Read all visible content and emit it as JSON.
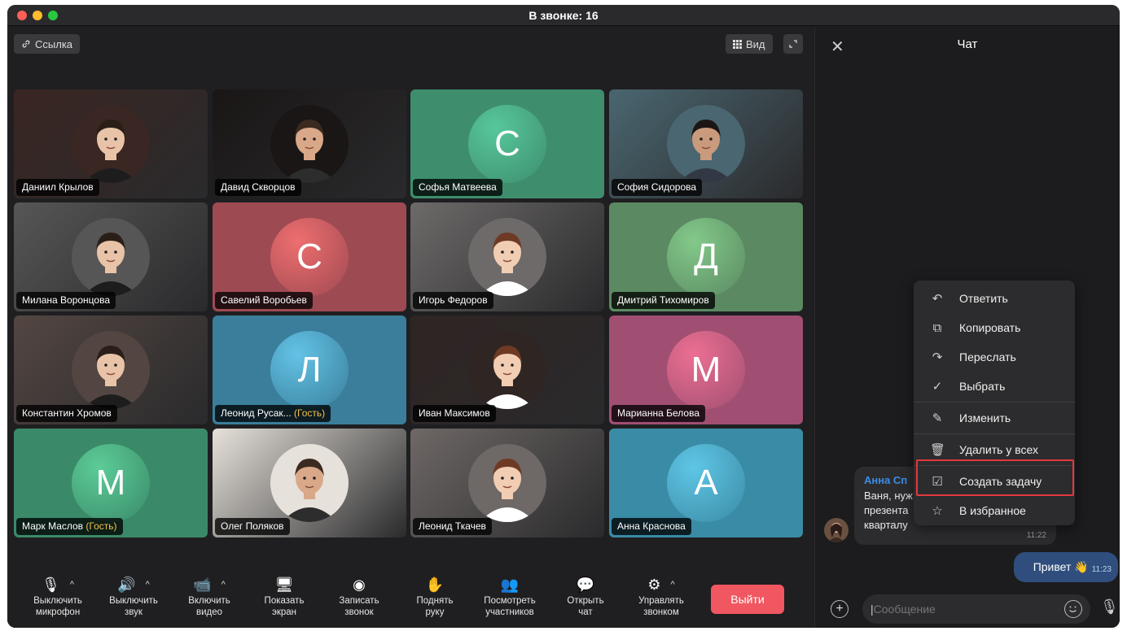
{
  "window": {
    "title": "В звонке: 16"
  },
  "stage": {
    "link_label": "Ссылка",
    "view_label": "Вид"
  },
  "participants": [
    {
      "name": "Даниил Крылов",
      "kind": "photo",
      "bg": "#3a2622"
    },
    {
      "name": "Давид Скворцов",
      "kind": "photo",
      "bg": "#1a1616"
    },
    {
      "name": "Софья Матвеева",
      "kind": "letter",
      "letter": "С",
      "bg": "#3e8e6e",
      "circle": "#57c79b"
    },
    {
      "name": "София Сидорова",
      "kind": "photo",
      "bg": "#4a6670"
    },
    {
      "name": "Милана Воронцова",
      "kind": "photo",
      "bg": "#575656"
    },
    {
      "name": "Савелий Воробьев",
      "kind": "letter",
      "letter": "С",
      "bg": "#9e4a52",
      "circle": "#ee6e6f"
    },
    {
      "name": "Игорь Федоров",
      "kind": "photo",
      "bg": "#6d6a69"
    },
    {
      "name": "Дмитрий Тихомиров",
      "kind": "letter",
      "letter": "Д",
      "bg": "#5b8a62",
      "circle": "#83c98a"
    },
    {
      "name": "Константин Хромов",
      "kind": "photo",
      "bg": "#534642"
    },
    {
      "name": "Леонид Русак...",
      "guest": "(Гость)",
      "kind": "letter",
      "letter": "Л",
      "bg": "#3a7e9b",
      "circle": "#63c3e6"
    },
    {
      "name": "Иван Максимов",
      "kind": "photo",
      "bg": "#2f2523"
    },
    {
      "name": "Марианна Белова",
      "kind": "letter",
      "letter": "М",
      "bg": "#a04f72",
      "circle": "#ec6f92"
    },
    {
      "name": "Марк Маслов",
      "guest": "(Гость)",
      "kind": "letter",
      "letter": "М",
      "bg": "#3a8a69",
      "circle": "#5ccc97"
    },
    {
      "name": "Олег Поляков",
      "kind": "photo",
      "bg": "#e6e1da"
    },
    {
      "name": "Леонид Ткачев",
      "kind": "photo",
      "bg": "#6e6866"
    },
    {
      "name": "Анна Краснова",
      "kind": "letter",
      "letter": "А",
      "bg": "#3a8ba5",
      "circle": "#5fc6e6"
    }
  ],
  "toolbar": {
    "mic": {
      "line1": "Выключить",
      "line2": "микрофон"
    },
    "sound": {
      "line1": "Выключить",
      "line2": "звук"
    },
    "video": {
      "line1": "Включить",
      "line2": "видео"
    },
    "screen": {
      "line1": "Показать",
      "line2": "экран"
    },
    "record": {
      "line1": "Записать",
      "line2": "звонок"
    },
    "hand": {
      "line1": "Поднять",
      "line2": "руку"
    },
    "members": {
      "line1": "Посмотреть",
      "line2": "участников"
    },
    "chat": {
      "line1": "Открыть",
      "line2": "чат"
    },
    "manage": {
      "line1": "Управлять",
      "line2": "звонком"
    },
    "leave": "Выйти"
  },
  "chat": {
    "title": "Чат",
    "incoming": {
      "sender": "Анна Сп",
      "line1": "Ваня, нуж",
      "line2": "презента",
      "line3": "кварталу",
      "time": "11:22"
    },
    "outgoing": {
      "text": "Привет 👋",
      "time": "11:23"
    },
    "composer_placeholder": "Сообщение"
  },
  "context_menu": {
    "items": [
      {
        "label": "Ответить",
        "icon": "reply-icon"
      },
      {
        "label": "Копировать",
        "icon": "copy-icon"
      },
      {
        "label": "Переслать",
        "icon": "forward-icon"
      },
      {
        "label": "Выбрать",
        "icon": "select-icon"
      },
      {
        "label": "Изменить",
        "icon": "edit-icon"
      },
      {
        "label": "Удалить у всех",
        "icon": "trash-icon"
      },
      {
        "label": "Создать задачу",
        "icon": "task-icon",
        "highlighted": true
      },
      {
        "label": "В избранное",
        "icon": "star-icon"
      }
    ]
  },
  "colors": {
    "accent": "#3d8ce8",
    "leave_button": "#f05760",
    "highlight_border": "#e2383f",
    "guest_label": "#f5c04a"
  }
}
